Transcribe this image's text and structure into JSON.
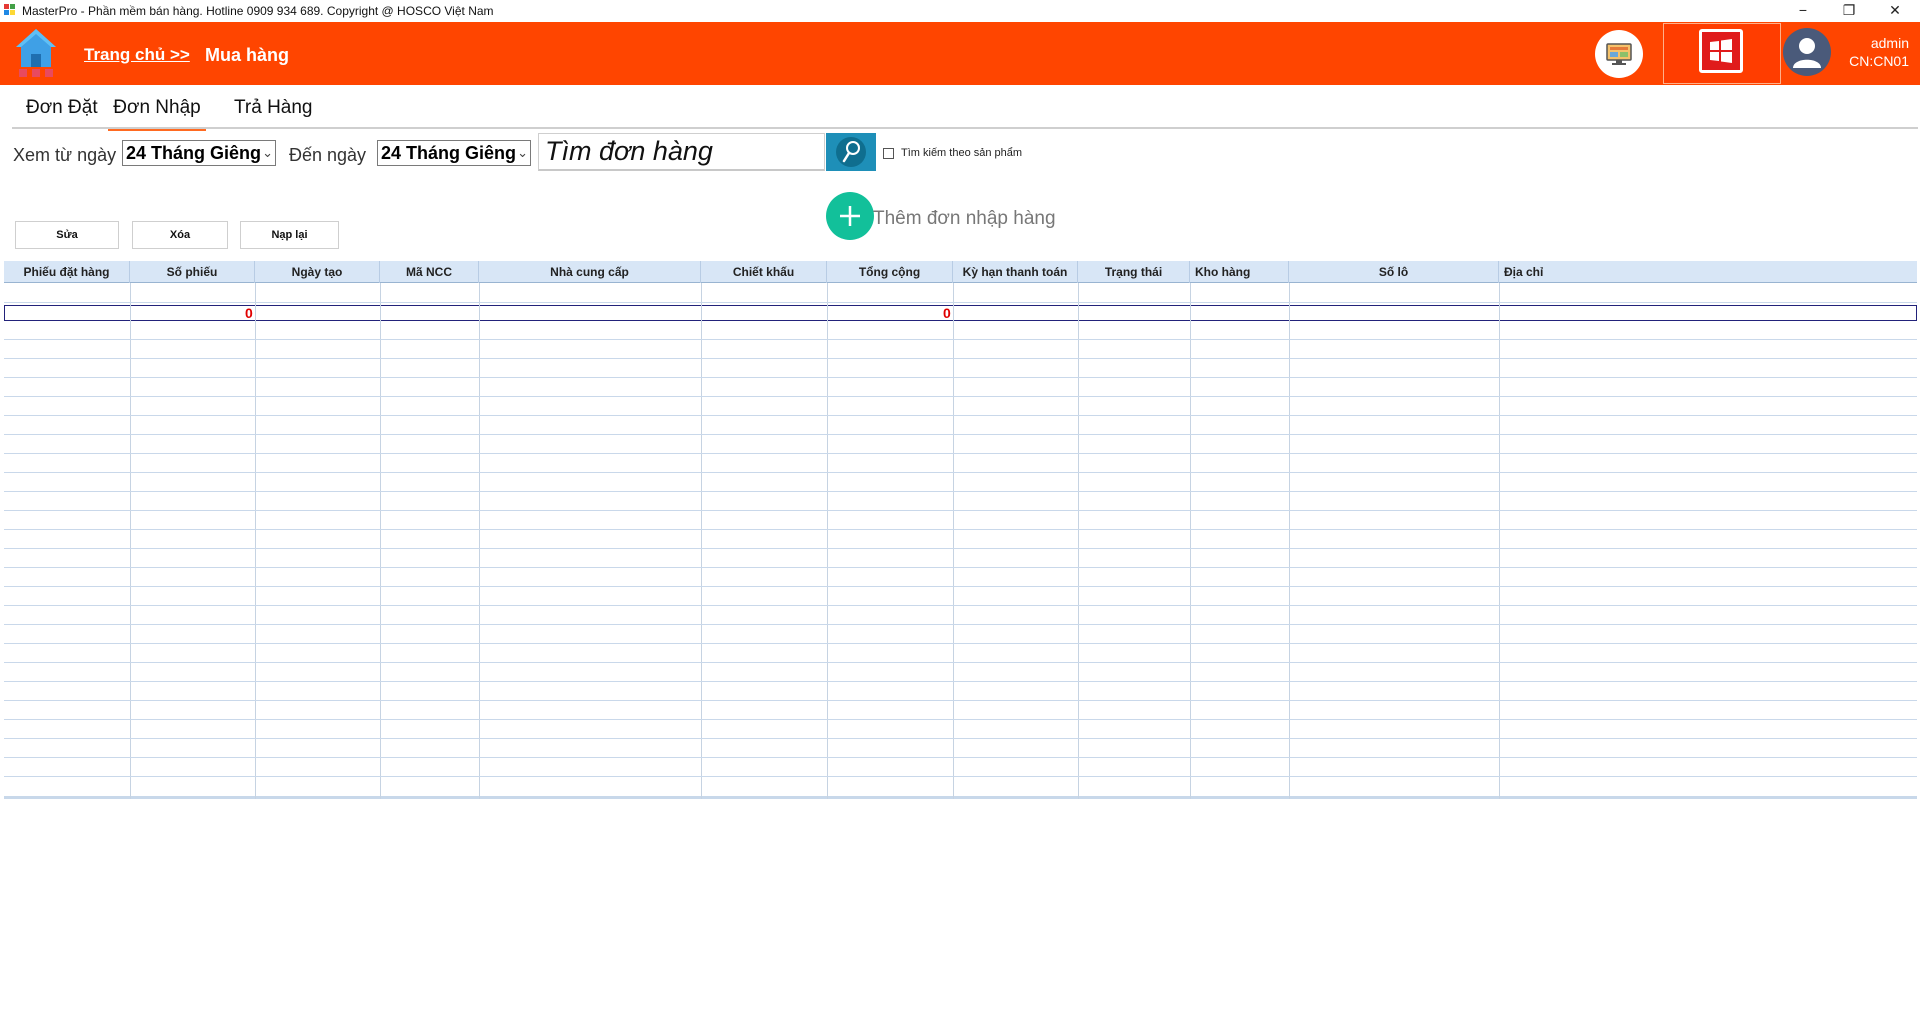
{
  "window": {
    "title": "MasterPro  - Phần mềm bán hàng. Hotline  0909 934 689. Copyright @ HOSCO Việt Nam",
    "minimize_glyph": "−",
    "maximize_glyph": "❐",
    "close_glyph": "✕"
  },
  "header": {
    "home_label": "Trang chủ >>",
    "current_page": "Mua hàng",
    "user_name": "admin",
    "branch": "CN:CN01",
    "background_color": "#ff4500"
  },
  "tabs": [
    {
      "label": "Đơn Đặt",
      "active": false
    },
    {
      "label": "Đơn Nhập",
      "active": true
    },
    {
      "label": "Trả Hàng",
      "active": false
    }
  ],
  "filters": {
    "from_label": "Xem từ ngày",
    "from_value": "24   Tháng Giêng",
    "to_label": "Đến ngày",
    "to_value": "24   Tháng Giêng",
    "search_value": "Tìm đơn hàng",
    "search_by_product_label": "Tìm kiếm theo sản phẩm"
  },
  "add_order_label": "Thêm đơn nhập hàng",
  "actions": {
    "edit": "Sửa",
    "delete": "Xóa",
    "reload": "Nạp lại"
  },
  "grid": {
    "columns": [
      "Phiếu đặt hàng",
      "Số phiếu",
      "Ngày tạo",
      "Mã NCC",
      "Nhà cung cấp",
      "Chiết khấu",
      "Tổng cộng",
      "Kỳ hạn thanh toán",
      "Trạng thái",
      "Kho hàng",
      "Số lô",
      "Địa chỉ"
    ],
    "summary": {
      "so_phieu": "0",
      "tong_cong": "0"
    }
  }
}
